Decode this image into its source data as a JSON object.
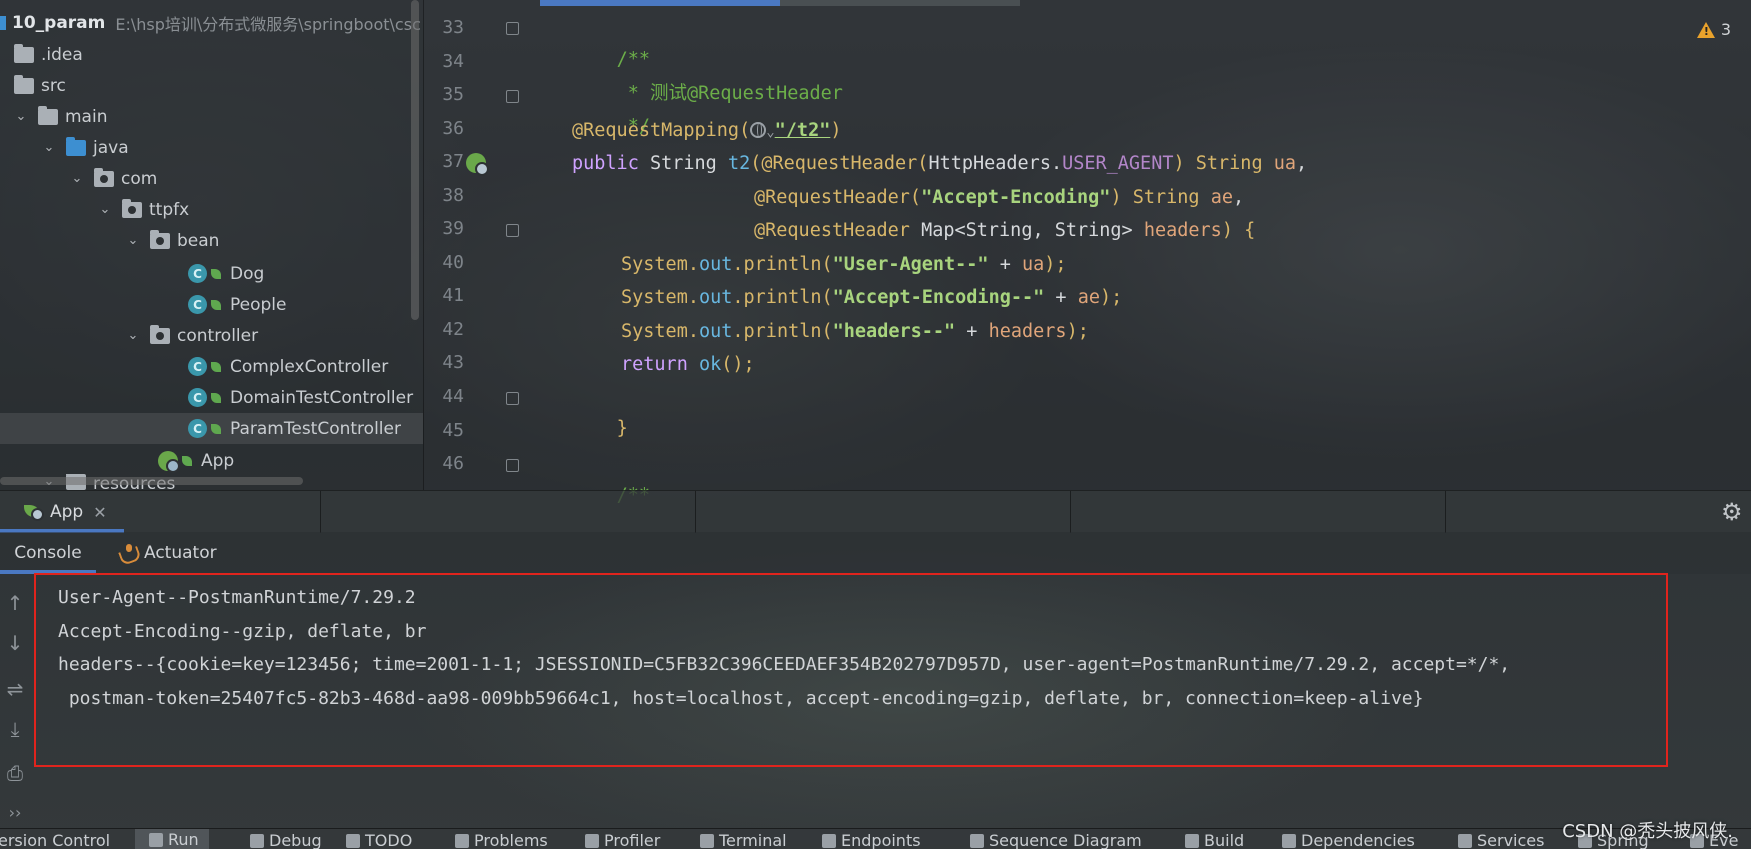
{
  "project": {
    "name": "10_param",
    "path": "E:\\hsp培训\\分布式微服务\\springboot\\csc",
    "tree": [
      {
        "label": ".idea",
        "type": "folder"
      },
      {
        "label": "src",
        "type": "folder"
      },
      {
        "label": "main",
        "type": "folder"
      },
      {
        "label": "java",
        "type": "folder-blue"
      },
      {
        "label": "com",
        "type": "package"
      },
      {
        "label": "ttpfx",
        "type": "package"
      },
      {
        "label": "bean",
        "type": "package"
      },
      {
        "label": "Dog",
        "type": "class"
      },
      {
        "label": "People",
        "type": "class"
      },
      {
        "label": "controller",
        "type": "package"
      },
      {
        "label": "ComplexController",
        "type": "class"
      },
      {
        "label": "DomainTestController",
        "type": "class"
      },
      {
        "label": "ParamTestController",
        "type": "class"
      },
      {
        "label": "App",
        "type": "app"
      },
      {
        "label": "resources",
        "type": "folder"
      }
    ]
  },
  "editor": {
    "warning_count": "3",
    "line_numbers": [
      "33",
      "34",
      "35",
      "36",
      "37",
      "38",
      "39",
      "40",
      "41",
      "42",
      "43",
      "44",
      "45",
      "46"
    ],
    "code": {
      "l33": "/**",
      "l34": " * 测试@RequestHeader",
      "l35": " */",
      "l36_ann": "@RequestMapping(",
      "l36_str": "\"/t2\"",
      "l36_end": ")",
      "l37_kw": "public",
      "l37_type": " String ",
      "l37_fn": "t2",
      "l37_p1": "(@RequestHeader(",
      "l37_cls": "HttpHeaders.",
      "l37_const": "USER_AGENT",
      "l37_p2": ") String ",
      "l37_param": "ua",
      "l37_end": ",",
      "l38_ann": "@RequestHeader(",
      "l38_str": "\"Accept-Encoding\"",
      "l38_p2": ") String ",
      "l38_param": "ae",
      "l38_end": ",",
      "l39_ann": "@RequestHeader",
      "l39_type": " Map<String, String> ",
      "l39_param": "headers",
      "l39_end": ") {",
      "l40_a": "System.",
      "l40_f": "out",
      "l40_b": ".println(",
      "l40_s": "\"User-Agent--\"",
      "l40_c": " + ",
      "l40_p": "ua",
      "l40_e": ");",
      "l41_a": "System.",
      "l41_f": "out",
      "l41_b": ".println(",
      "l41_s": "\"Accept-Encoding--\"",
      "l41_c": " + ",
      "l41_p": "ae",
      "l41_e": ");",
      "l42_a": "System.",
      "l42_f": "out",
      "l42_b": ".println(",
      "l42_s": "\"headers--\"",
      "l42_c": " + ",
      "l42_p": "headers",
      "l42_e": ");",
      "l43_kw": "return",
      "l43_fn": " ok",
      "l43_e": "();",
      "l44": "}",
      "l46": "/**"
    }
  },
  "run": {
    "tab_label": "App",
    "console_tab": "Console",
    "actuator_tab": "Actuator",
    "output": [
      "User-Agent--PostmanRuntime/7.29.2",
      "Accept-Encoding--gzip, deflate, br",
      "headers--{cookie=key=123456; time=2001-1-1; JSESSIONID=C5FB32C396CEEDAEF354B202797D957D, user-agent=PostmanRuntime/7.29.2, accept=*/*,",
      " postman-token=25407fc5-82b3-468d-aa98-009bb59664c1, host=localhost, accept-encoding=gzip, deflate, br, connection=keep-alive}"
    ]
  },
  "bottom_bar": {
    "items": [
      "ersion Control",
      "Run",
      "Debug",
      "TODO",
      "Problems",
      "Profiler",
      "Terminal",
      "Endpoints",
      "Sequence Diagram",
      "Build",
      "Dependencies",
      "Services",
      "Spring",
      "Eve"
    ]
  },
  "watermark": "CSDN @秃头披风侠.",
  "colors": {
    "accent": "#4a78c2",
    "highlight_box": "#e0241d",
    "warning": "#e9a22c"
  }
}
